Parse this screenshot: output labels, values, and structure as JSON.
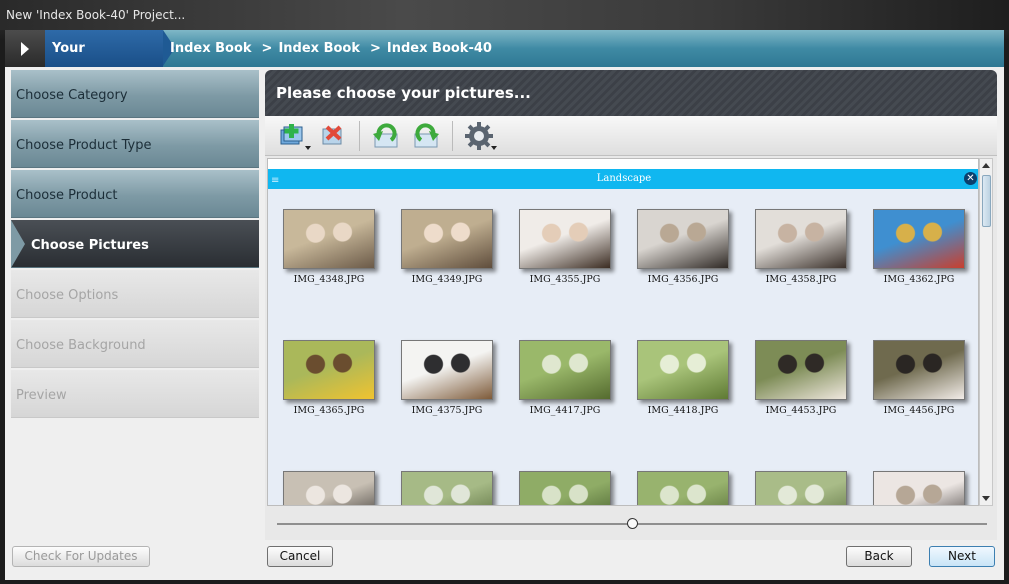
{
  "window": {
    "title": "New 'Index Book-40' Project..."
  },
  "breadcrumb": {
    "label": "Your Selections:",
    "path": [
      "Index Book",
      "Index Book",
      "Index Book-40"
    ],
    "separator": ">"
  },
  "steps": [
    {
      "label": "Choose Category",
      "state": "done"
    },
    {
      "label": "Choose Product Type",
      "state": "done"
    },
    {
      "label": "Choose Product",
      "state": "done"
    },
    {
      "label": "Choose Pictures",
      "state": "active"
    },
    {
      "label": "Choose Options",
      "state": "disabled"
    },
    {
      "label": "Choose Background",
      "state": "disabled"
    },
    {
      "label": "Preview",
      "state": "disabled"
    }
  ],
  "panel": {
    "title": "Please choose your pictures...",
    "toolbar": [
      {
        "icon": "add-pictures-icon",
        "dropdown": true
      },
      {
        "icon": "remove-pictures-icon",
        "dropdown": false
      },
      {
        "icon": "rotate-left-icon",
        "dropdown": false
      },
      {
        "icon": "rotate-right-icon",
        "dropdown": false
      },
      {
        "icon": "settings-gear-icon",
        "dropdown": true
      }
    ],
    "group": {
      "label": "Landscape"
    },
    "pictures": [
      {
        "name": "IMG_4348.JPG",
        "colors": [
          "#c8b89a",
          "#6b5a48",
          "#e9d8c6"
        ]
      },
      {
        "name": "IMG_4349.JPG",
        "colors": [
          "#bfae90",
          "#5f4d3c",
          "#eedccb"
        ]
      },
      {
        "name": "IMG_4355.JPG",
        "colors": [
          "#f0ece8",
          "#3b2c22",
          "#e4cdb8"
        ]
      },
      {
        "name": "IMG_4356.JPG",
        "colors": [
          "#d9d5d0",
          "#302a26",
          "#b9a894"
        ]
      },
      {
        "name": "IMG_4358.JPG",
        "colors": [
          "#e2ded9",
          "#3a302a",
          "#c7b3a2"
        ]
      },
      {
        "name": "IMG_4362.JPG",
        "colors": [
          "#3f8fd0",
          "#c93f2e",
          "#d7b04a"
        ]
      },
      {
        "name": "IMG_4365.JPG",
        "colors": [
          "#aab85a",
          "#f0c330",
          "#6a4d2f"
        ]
      },
      {
        "name": "IMG_4375.JPG",
        "colors": [
          "#f4f4f2",
          "#7e5b3a",
          "#2e2e30"
        ]
      },
      {
        "name": "IMG_4417.JPG",
        "colors": [
          "#9ab86a",
          "#556b2f",
          "#dfe7cf"
        ]
      },
      {
        "name": "IMG_4418.JPG",
        "colors": [
          "#a9c47a",
          "#5f7a34",
          "#e6eed6"
        ]
      },
      {
        "name": "IMG_4453.JPG",
        "colors": [
          "#7d8c56",
          "#efe7de",
          "#2f2a26"
        ]
      },
      {
        "name": "IMG_4456.JPG",
        "colors": [
          "#6f6a4e",
          "#f2ece8",
          "#2a2623"
        ]
      },
      {
        "name": "",
        "colors": [
          "#c8c0b4",
          "#2c2825",
          "#ece6e0"
        ]
      },
      {
        "name": "",
        "colors": [
          "#a6ba86",
          "#4d6133",
          "#e0e6d8"
        ]
      },
      {
        "name": "",
        "colors": [
          "#8fac66",
          "#3d5526",
          "#d8e2c8"
        ]
      },
      {
        "name": "",
        "colors": [
          "#98b36e",
          "#4a612c",
          "#dce5cd"
        ]
      },
      {
        "name": "",
        "colors": [
          "#a9bc88",
          "#55693a",
          "#e3e9d8"
        ]
      },
      {
        "name": "",
        "colors": [
          "#ece6e3",
          "#2e2825",
          "#b6a796"
        ]
      }
    ],
    "zoom": {
      "value": 0.5
    }
  },
  "buttons": {
    "check_updates": "Check For Updates",
    "cancel": "Cancel",
    "back": "Back",
    "next": "Next"
  }
}
